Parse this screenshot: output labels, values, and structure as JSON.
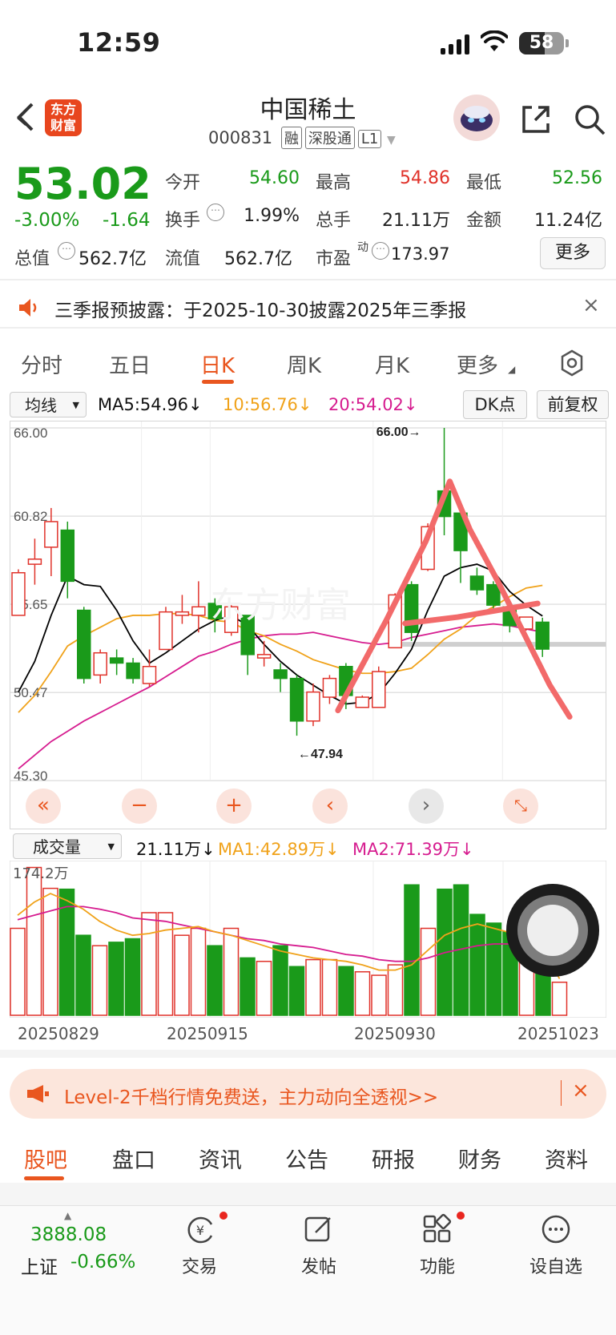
{
  "status_bar": {
    "time": "12:59",
    "battery": "58"
  },
  "header": {
    "app_logo": "东方\n财富",
    "stock_name": "中国稀土",
    "stock_code": "000831",
    "tags": [
      "融",
      "深股通",
      "L1"
    ],
    "icons": [
      "back-icon",
      "robot-avatar",
      "share-icon",
      "search-icon"
    ]
  },
  "quote": {
    "price": "53.02",
    "change_pct": "-3.00%",
    "change_amt": "-1.64",
    "rows": [
      [
        {
          "label": "今开",
          "value": "54.60",
          "color": "green"
        },
        {
          "label": "最高",
          "value": "54.86",
          "color": "red"
        },
        {
          "label": "最低",
          "value": "52.56",
          "color": "green"
        }
      ],
      [
        {
          "label": "换手",
          "value": "1.99%",
          "color": "dark"
        },
        {
          "label": "总手",
          "value": "21.11万",
          "color": "dark"
        },
        {
          "label": "金额",
          "value": "11.24亿",
          "color": "dark"
        }
      ]
    ],
    "total_value_label": "总值",
    "total_value": "562.7亿",
    "float_value_label": "流值",
    "float_value": "562.7亿",
    "pe_label": "市盈",
    "pe_sup": "动",
    "pe_value": "173.97",
    "more_label": "更多"
  },
  "notice": {
    "text": "三季报预披露：于2025-10-30披露2025年三季报",
    "close": "×"
  },
  "chart_tabs": [
    "分时",
    "五日",
    "日K",
    "周K",
    "月K",
    "更多"
  ],
  "ma_bar": {
    "select": "均线",
    "ma5": "MA5:54.96↓",
    "ma10": "10:56.76↓",
    "ma20": "20:54.02↓",
    "dk_button": "DK点",
    "fq_button": "前复权"
  },
  "chart_data": {
    "type": "candlestick",
    "ylim": [
      45.3,
      66.0
    ],
    "y_ticks": [
      "66.00",
      "60.82",
      "55.65",
      "50.47",
      "45.30"
    ],
    "annotations": {
      "high": "66.00→",
      "low": "←47.94"
    },
    "candles": [
      [
        55.0,
        57.5,
        55.0,
        57.7
      ],
      [
        58.0,
        58.3,
        56.8,
        59.5
      ],
      [
        59.0,
        60.5,
        57.3,
        61.3
      ],
      [
        60.0,
        57.0,
        56.0,
        60.5
      ],
      [
        55.3,
        51.3,
        51.0,
        55.5
      ],
      [
        51.5,
        52.8,
        51.0,
        53.0
      ],
      [
        52.5,
        52.2,
        51.5,
        53.0
      ],
      [
        52.2,
        51.3,
        51.0,
        52.5
      ],
      [
        51.0,
        52.0,
        50.8,
        53.0
      ],
      [
        53.0,
        55.2,
        53.0,
        55.5
      ],
      [
        55.0,
        55.2,
        54.5,
        56.2
      ],
      [
        55.0,
        55.5,
        54.0,
        57.0
      ],
      [
        55.7,
        54.8,
        54.0,
        56.0
      ],
      [
        54.0,
        55.5,
        53.8,
        55.7
      ],
      [
        55.0,
        52.7,
        51.5,
        55.0
      ],
      [
        52.5,
        52.7,
        52.0,
        53.5
      ],
      [
        51.8,
        51.3,
        50.5,
        52.2
      ],
      [
        51.3,
        48.8,
        47.94,
        51.5
      ],
      [
        48.8,
        50.5,
        48.5,
        51.0
      ],
      [
        50.2,
        51.3,
        49.8,
        51.5
      ],
      [
        52.0,
        50.3,
        49.5,
        52.2
      ],
      [
        49.6,
        50.2,
        49.6,
        50.3
      ],
      [
        49.6,
        51.7,
        49.6,
        52.0
      ],
      [
        53.1,
        56.2,
        53.1,
        56.3
      ],
      [
        56.8,
        54.0,
        53.5,
        57.0
      ],
      [
        57.7,
        60.2,
        57.6,
        60.4
      ],
      [
        62.3,
        60.8,
        59.7,
        66.0
      ],
      [
        61.0,
        58.8,
        56.9,
        61.4
      ],
      [
        57.3,
        56.5,
        56.2,
        57.8
      ],
      [
        56.8,
        55.6,
        55.2,
        57.0
      ],
      [
        55.5,
        54.4,
        54.0,
        55.7
      ],
      [
        54.2,
        54.9,
        54.1,
        54.9
      ],
      [
        54.6,
        53.02,
        52.56,
        54.86
      ]
    ],
    "ma5": [
      50.5,
      52.3,
      55.0,
      57.3,
      56.8,
      56.7,
      55.3,
      53.5,
      52.2,
      52.8,
      53.5,
      54.2,
      54.7,
      55.0,
      54.4,
      53.3,
      52.3,
      51.5,
      50.9,
      50.3,
      49.8,
      49.9,
      50.4,
      51.6,
      53.0,
      55.3,
      57.3,
      57.8,
      58.0,
      57.6,
      56.4,
      55.6,
      54.96
    ],
    "ma10": [
      49.3,
      50.3,
      51.7,
      53.2,
      53.8,
      54.3,
      54.8,
      55.0,
      55.0,
      55.1,
      55.1,
      55.0,
      54.7,
      54.6,
      54.1,
      53.8,
      53.3,
      52.9,
      52.4,
      52.1,
      51.8,
      51.6,
      51.6,
      51.7,
      51.9,
      52.7,
      53.6,
      54.2,
      55.0,
      55.5,
      56.1,
      56.6,
      56.76
    ],
    "ma20": [
      46.0,
      46.8,
      47.6,
      48.2,
      48.8,
      49.3,
      49.8,
      50.3,
      50.8,
      51.4,
      52.0,
      52.6,
      52.9,
      53.3,
      53.6,
      53.8,
      53.9,
      53.9,
      54.0,
      53.8,
      53.6,
      53.4,
      53.3,
      53.4,
      53.7,
      53.9,
      54.1,
      54.3,
      54.4,
      54.5,
      54.4,
      54.2,
      54.02
    ]
  },
  "chart_controls": [
    "chevrons-left-icon",
    "zoom-out-icon",
    "zoom-in-icon",
    "scroll-left-icon",
    "scroll-right-icon",
    "fullscreen-icon"
  ],
  "volume_bar": {
    "select": "成交量",
    "vol": "21.11万↓",
    "ma1": "MA1:42.89万↓",
    "ma2": "MA2:71.39万↓",
    "max_label": "174.2万"
  },
  "volume_data": {
    "max": 174.2,
    "values": [
      100,
      170,
      146,
      145,
      92,
      80,
      84,
      88,
      118,
      118,
      92,
      100,
      80,
      100,
      66,
      62,
      80,
      56,
      64,
      64,
      56,
      50,
      46,
      58,
      150,
      100,
      145,
      150,
      116,
      106,
      96,
      78,
      60,
      38
    ],
    "ma1": [
      115,
      130,
      140,
      132,
      122,
      108,
      98,
      92,
      94,
      98,
      100,
      102,
      96,
      92,
      86,
      80,
      74,
      70,
      66,
      64,
      62,
      58,
      52,
      52,
      58,
      75,
      92,
      100,
      105,
      100,
      95,
      88,
      75,
      42
    ],
    "ma2": [
      110,
      115,
      120,
      125,
      125,
      122,
      118,
      112,
      110,
      108,
      104,
      100,
      96,
      92,
      88,
      86,
      82,
      80,
      78,
      74,
      70,
      68,
      64,
      62,
      62,
      66,
      72,
      76,
      80,
      82,
      82,
      80,
      76,
      71
    ],
    "dates": [
      "20250829",
      "20250915",
      "20250930",
      "20251023"
    ]
  },
  "banner": {
    "text": "Level-2千档行情免费送，主力动向全透视>>",
    "close": "×"
  },
  "bottom_tabs": [
    "股吧",
    "盘口",
    "资讯",
    "公告",
    "研报",
    "财务",
    "资料"
  ],
  "bottom_nav": {
    "index_value": "3888.08",
    "index_label": "上证",
    "index_change": "-0.66%",
    "items": [
      {
        "label": "交易",
        "icon": "yuan-exchange-icon"
      },
      {
        "label": "发帖",
        "icon": "compose-icon"
      },
      {
        "label": "功能",
        "icon": "apps-grid-icon"
      },
      {
        "label": "设自选",
        "icon": "more-circle-icon"
      }
    ]
  },
  "colors": {
    "up": "#e0322a",
    "down": "#1a9a1a",
    "accent": "#e9561f",
    "ma5": "#000000",
    "ma10": "#f0a21a",
    "ma20": "#d61c8f",
    "drawing": "#f26a6a"
  }
}
